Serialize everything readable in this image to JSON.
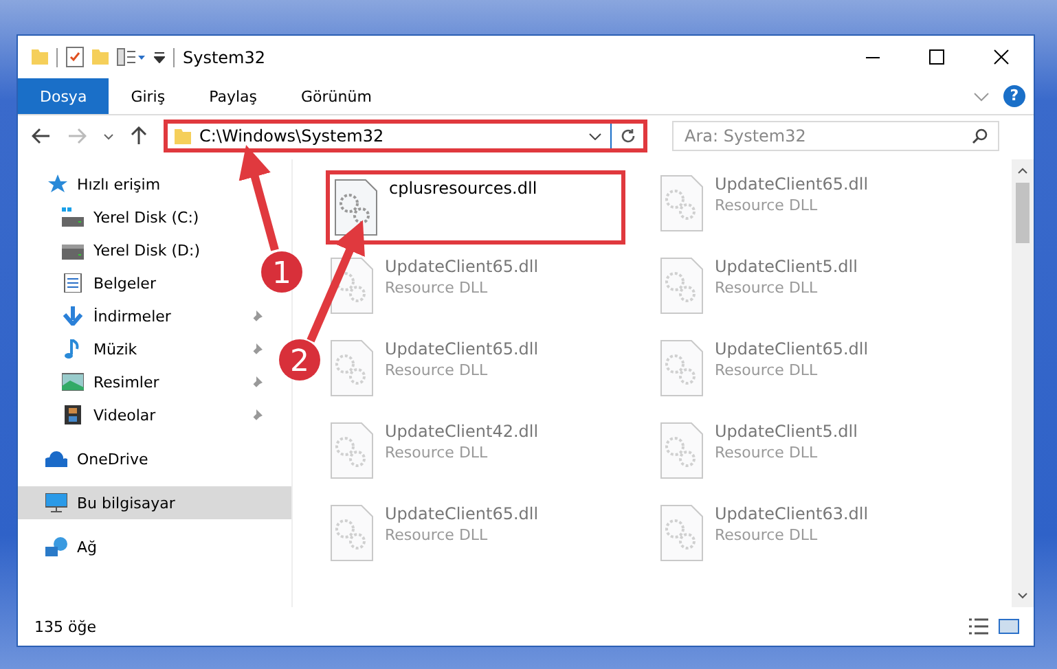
{
  "window": {
    "title": "System32"
  },
  "ribbon_tabs": [
    {
      "label": "Dosya",
      "selected": true
    },
    {
      "label": "Giriş",
      "selected": false
    },
    {
      "label": "Paylaş",
      "selected": false
    },
    {
      "label": "Görünüm",
      "selected": false
    }
  ],
  "help": "?",
  "address": {
    "path": "C:\\Windows\\System32",
    "highlighted": true
  },
  "search": {
    "placeholder": "Ara: System32"
  },
  "sidebar": {
    "items": [
      {
        "label": "Hızlı erişim",
        "selected": false,
        "children": [
          {
            "label": "Yerel Disk (C:)",
            "pinned": false,
            "selected": false
          },
          {
            "label": "Yerel Disk (D:)",
            "pinned": false,
            "selected": false
          },
          {
            "label": "Belgeler",
            "pinned": false,
            "selected": false
          },
          {
            "label": "İndirmeler",
            "pinned": true,
            "selected": false
          },
          {
            "label": "Müzik",
            "pinned": true,
            "selected": false
          },
          {
            "label": "Resimler",
            "pinned": true,
            "selected": false
          },
          {
            "label": "Videolar",
            "pinned": true,
            "selected": false
          }
        ]
      },
      {
        "label": "OneDrive",
        "selected": false
      },
      {
        "label": "Bu bilgisayar",
        "selected": true
      },
      {
        "label": "Ağ",
        "selected": false
      }
    ]
  },
  "files": [
    {
      "name": "cplusresources.dll",
      "highlighted": true,
      "blurred": false
    },
    {
      "name": "UpdateClient65.dll",
      "type": "Resource DLL",
      "highlighted": false,
      "blurred": true
    },
    {
      "name": "UpdateClient65.dll",
      "type": "Resource DLL",
      "highlighted": false,
      "blurred": true
    },
    {
      "name": "UpdateClient5.dll",
      "type": "Resource DLL",
      "highlighted": false,
      "blurred": true
    },
    {
      "name": "UpdateClient65.dll",
      "type": "Resource DLL",
      "highlighted": false,
      "blurred": true
    },
    {
      "name": "UpdateClient65.dll",
      "type": "Resource DLL",
      "highlighted": false,
      "blurred": true
    },
    {
      "name": "UpdateClient42.dll",
      "type": "Resource DLL",
      "highlighted": false,
      "blurred": true
    },
    {
      "name": "UpdateClient5.dll",
      "type": "Resource DLL",
      "highlighted": false,
      "blurred": true
    },
    {
      "name": "UpdateClient65.dll",
      "type": "Resource DLL",
      "highlighted": false,
      "blurred": true
    },
    {
      "name": "UpdateClient63.dll",
      "type": "Resource DLL",
      "highlighted": false,
      "blurred": true
    }
  ],
  "status_bar": {
    "count": "135 öğe"
  },
  "annotations": [
    {
      "number": "1"
    },
    {
      "number": "2"
    }
  ]
}
